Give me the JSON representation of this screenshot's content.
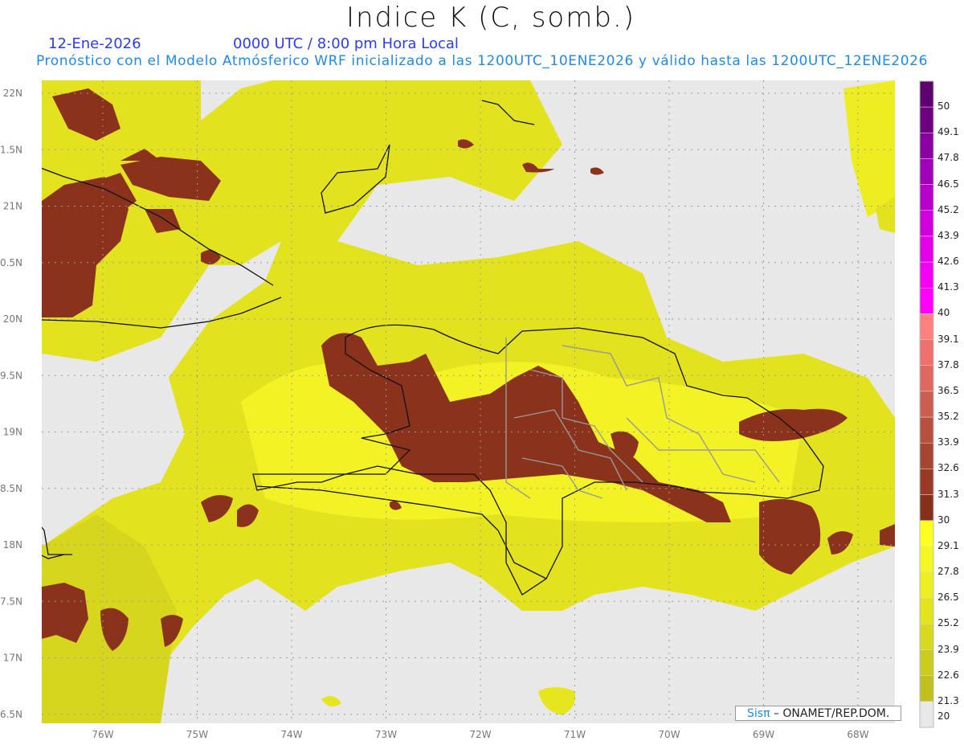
{
  "header": {
    "title": "Indice K (C, somb.)",
    "date": "12-Ene-2026",
    "time": "0000 UTC / 8:00 pm Hora Local",
    "forecast_info": "Pronóstico con el Modelo Atmósferico WRF inicializado a las 1200UTC_10ENE2026 y válido hasta las  1200UTC_12ENE2026"
  },
  "axes": {
    "lon_labels": [
      "76W",
      "75W",
      "74W",
      "73W",
      "72W",
      "71W",
      "70W",
      "69W",
      "68W"
    ],
    "lat_labels": [
      "22N",
      "1.5N",
      "21N",
      "0.5N",
      "20N",
      "9.5N",
      "19N",
      "8.5N",
      "18N",
      "7.5N",
      "17N",
      "6.5N"
    ]
  },
  "colorbar": {
    "labels": [
      "50",
      "49.1",
      "47.8",
      "46.5",
      "45.2",
      "43.9",
      "42.6",
      "41.3",
      "40",
      "39.1",
      "37.8",
      "36.5",
      "35.2",
      "33.9",
      "32.6",
      "31.3",
      "30",
      "29.1",
      "27.8",
      "26.5",
      "25.2",
      "23.9",
      "22.6",
      "21.3",
      "20"
    ],
    "colors": [
      "#5e006e",
      "#6e0080",
      "#8a00a0",
      "#a000b8",
      "#b800cc",
      "#d000dd",
      "#e400e8",
      "#f400f4",
      "#ff00ff",
      "#ff8080",
      "#f07070",
      "#e06860",
      "#cc5e50",
      "#b85040",
      "#a84432",
      "#983a26",
      "#86301a",
      "#ffff20",
      "#f6f622",
      "#eeee20",
      "#e4e41e",
      "#d8d81e",
      "#cccc1e",
      "#c0c01e",
      "#e8e8e8"
    ]
  },
  "credit": {
    "brand": "Sisπ",
    "text": "– ONAMET/REP.DOM."
  }
}
